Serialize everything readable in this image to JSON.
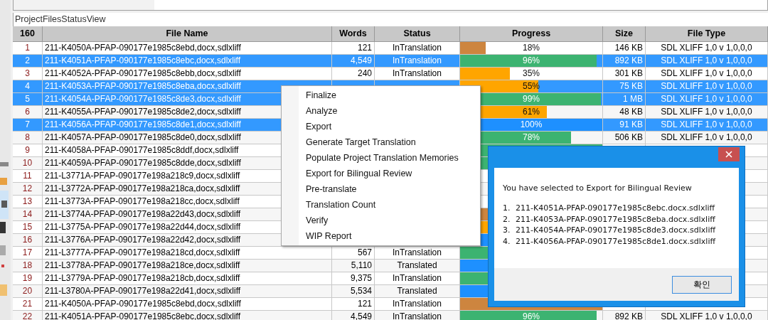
{
  "view_title": "ProjectFilesStatusView",
  "table": {
    "columns": [
      "160",
      "File Name",
      "Words",
      "Status",
      "Progress",
      "Size",
      "File Type"
    ],
    "rows": [
      {
        "num": "1",
        "file": "211-K4050A-PFAP-090177e1985c8ebd,docx,sdlxliff",
        "words": "121",
        "status": "InTranslation",
        "progress": {
          "level": 0.18,
          "label": "18%",
          "color": "#cd853f"
        },
        "size": "146 KB",
        "type": "SDL XLIFF 1,0 v 1,0,0,0",
        "selected": false
      },
      {
        "num": "2",
        "file": "211-K4051A-PFAP-090177e1985c8ebc,docx,sdlxliff",
        "words": "4,549",
        "status": "InTranslation",
        "progress": {
          "level": 0.96,
          "label": "96%",
          "color": "#3cb371"
        },
        "size": "892 KB",
        "type": "SDL XLIFF 1,0 v 1,0,0,0",
        "selected": true
      },
      {
        "num": "3",
        "file": "211-K4052A-PFAP-090177e1985c8ebb,docx,sdlxliff",
        "words": "240",
        "status": "InTranslation",
        "progress": {
          "level": 0.35,
          "label": "35%",
          "color": "#ffa500"
        },
        "size": "301 KB",
        "type": "SDL XLIFF 1,0 v 1,0,0,0",
        "selected": false
      },
      {
        "num": "4",
        "file": "211-K4053A-PFAP-090177e1985c8eba,docx,sdlxliff",
        "progress": {
          "level": 0.55,
          "label": "55%",
          "color": "#ffa500"
        },
        "size": "75 KB",
        "type": "SDL XLIFF 1,0 v 1,0,0,0",
        "selected": true
      },
      {
        "num": "5",
        "file": "211-K4054A-PFAP-090177e1985c8de3,docx,sdlxliff",
        "progress": {
          "level": 0.99,
          "label": "99%",
          "color": "#3cb371"
        },
        "size": "1 MB",
        "type": "SDL XLIFF 1,0 v 1,0,0,0",
        "selected": true
      },
      {
        "num": "6",
        "file": "211-K4055A-PFAP-090177e1985c8de2,docx,sdlxliff",
        "progress": {
          "level": 0.61,
          "label": "61%",
          "color": "#ffa500"
        },
        "size": "48 KB",
        "type": "SDL XLIFF 1,0 v 1,0,0,0",
        "selected": false
      },
      {
        "num": "7",
        "file": "211-K4056A-PFAP-090177e1985c8de1,docx,sdlxliff",
        "progress": {
          "level": 1,
          "label": "100%",
          "color": "#1e90ff"
        },
        "size": "91 KB",
        "type": "SDL XLIFF 1,0 v 1,0,0,0",
        "selected": true
      },
      {
        "num": "8",
        "file": "211-K4057A-PFAP-090177e1985c8de0,docx,sdlxliff",
        "progress": {
          "level": 0.78,
          "label": "78%",
          "color": "#3cb371"
        },
        "size": "506 KB",
        "type": "SDL XLIFF 1,0 v 1,0,0,0",
        "selected": false
      },
      {
        "num": "9",
        "file": "211-K4058A-PFAP-090177e1985c8ddf,docx,sdlxliff",
        "progress": {
          "color": "#3cb371"
        },
        "selected": false
      },
      {
        "num": "10",
        "file": "211-K4059A-PFAP-090177e1985c8dde,docx,sdlxliff",
        "progress": {
          "color": "#3cb371"
        },
        "selected": false
      },
      {
        "num": "11",
        "file": "211-L3771A-PFAP-090177e198a218c9,docx,sdlxliff",
        "selected": false
      },
      {
        "num": "12",
        "file": "211-L3772A-PFAP-090177e198a218ca,docx,sdlxliff",
        "selected": false
      },
      {
        "num": "13",
        "file": "211-L3773A-PFAP-090177e198a218cc,docx,sdlxliff",
        "selected": false
      },
      {
        "num": "14",
        "file": "211-L3774A-PFAP-090177e198a22d43,docx,sdlxliff",
        "progress": {
          "color": "#cd853f"
        },
        "selected": false
      },
      {
        "num": "15",
        "file": "211-L3775A-PFAP-090177e198a22d44,docx,sdlxliff",
        "progress": {
          "color": "#ffa500"
        },
        "selected": false
      },
      {
        "num": "16",
        "file": "211-L3776A-PFAP-090177e198a22d42,docx,sdlxliff",
        "progress": {
          "color": "#1e90ff"
        },
        "selected": false
      },
      {
        "num": "17",
        "file": "211-L3777A-PFAP-090177e198a218cd,docx,sdlxliff",
        "words": "567",
        "status": "InTranslation",
        "progress": {
          "color": "#3cb371"
        },
        "selected": false
      },
      {
        "num": "18",
        "file": "211-L3778A-PFAP-090177e198a218ce,docx,sdlxliff",
        "words": "5,110",
        "status": "Translated",
        "progress": {
          "color": "#1e90ff"
        },
        "selected": false
      },
      {
        "num": "19",
        "file": "211-L3779A-PFAP-090177e198a218cb,docx,sdlxliff",
        "words": "9,375",
        "status": "InTranslation",
        "progress": {
          "color": "#3cb371"
        },
        "selected": false
      },
      {
        "num": "20",
        "file": "211-L3780A-PFAP-090177e198a22d41,docx,sdlxliff",
        "words": "5,534",
        "status": "Translated",
        "progress": {
          "color": "#1e90ff"
        },
        "selected": false
      },
      {
        "num": "21",
        "file": "211-K4050A-PFAP-090177e1985c8ebd,docx,sdlxliff",
        "words": "121",
        "status": "InTranslation",
        "progress": {
          "color": "#cd853f"
        },
        "selected": false
      },
      {
        "num": "22",
        "file": "211-K4051A-PFAP-090177e1985c8ebc,docx,sdlxliff",
        "words": "4,549",
        "status": "InTranslation",
        "progress": {
          "level": 0.96,
          "label": "96%",
          "color": "#3cb371"
        },
        "size": "892 KB",
        "type": "SDL XLIFF 1,0 v 1,0,0,0",
        "selected": false
      }
    ]
  },
  "context_menu": {
    "items": [
      "Finalize",
      "Analyze",
      "Export",
      "Generate Target Translation",
      "Populate Project Translation Memories",
      "Export for Bilingual Review",
      "Pre-translate",
      "Translation Count",
      "Verify",
      "WIP Report"
    ]
  },
  "dialog": {
    "message": "You have selected to Export for Bilingual Review",
    "files": [
      {
        "number": "1.",
        "name": "211-K4051A-PFAP-090177e1985c8ebc.docx.sdlxliff"
      },
      {
        "number": "2.",
        "name": "211-K4053A-PFAP-090177e1985c8eba.docx.sdlxliff"
      },
      {
        "number": "3.",
        "name": "211-K4054A-PFAP-090177e1985c8de3.docx.sdlxliff"
      },
      {
        "number": "4.",
        "name": "211-K4056A-PFAP-090177e1985c8de1.docx.sdlxliff"
      }
    ],
    "button": "확인"
  }
}
